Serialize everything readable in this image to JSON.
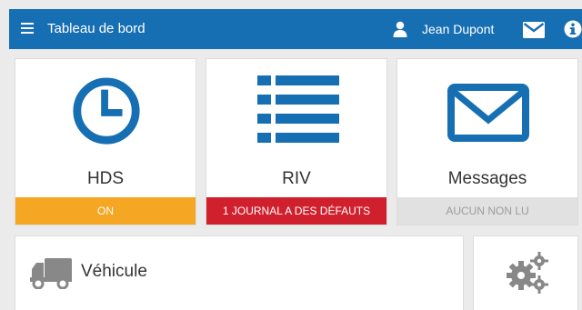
{
  "header": {
    "title": "Tableau de bord",
    "user_name": "Jean Dupont",
    "menu_icon": "hamburger-menu-icon",
    "user_icon": "user-icon",
    "mail_icon": "envelope-icon",
    "info_icon": "info-icon",
    "bar_color": "#176fb3"
  },
  "tiles": [
    {
      "label": "HDS",
      "status": "ON",
      "status_color": "#f5a623",
      "icon": "clock-icon"
    },
    {
      "label": "RIV",
      "status": "1 JOURNAL A DES DÉFAUTS",
      "status_color": "#d0202e",
      "icon": "list-icon"
    },
    {
      "label": "Messages",
      "status": "AUCUN NON LU",
      "status_color": "#e1e1e1",
      "icon": "envelope-icon"
    }
  ],
  "bottom_tiles": [
    {
      "label": "Véhicule",
      "icon": "truck-icon"
    },
    {
      "label": "",
      "icon": "gears-icon"
    }
  ],
  "accent_color": "#176fb3"
}
